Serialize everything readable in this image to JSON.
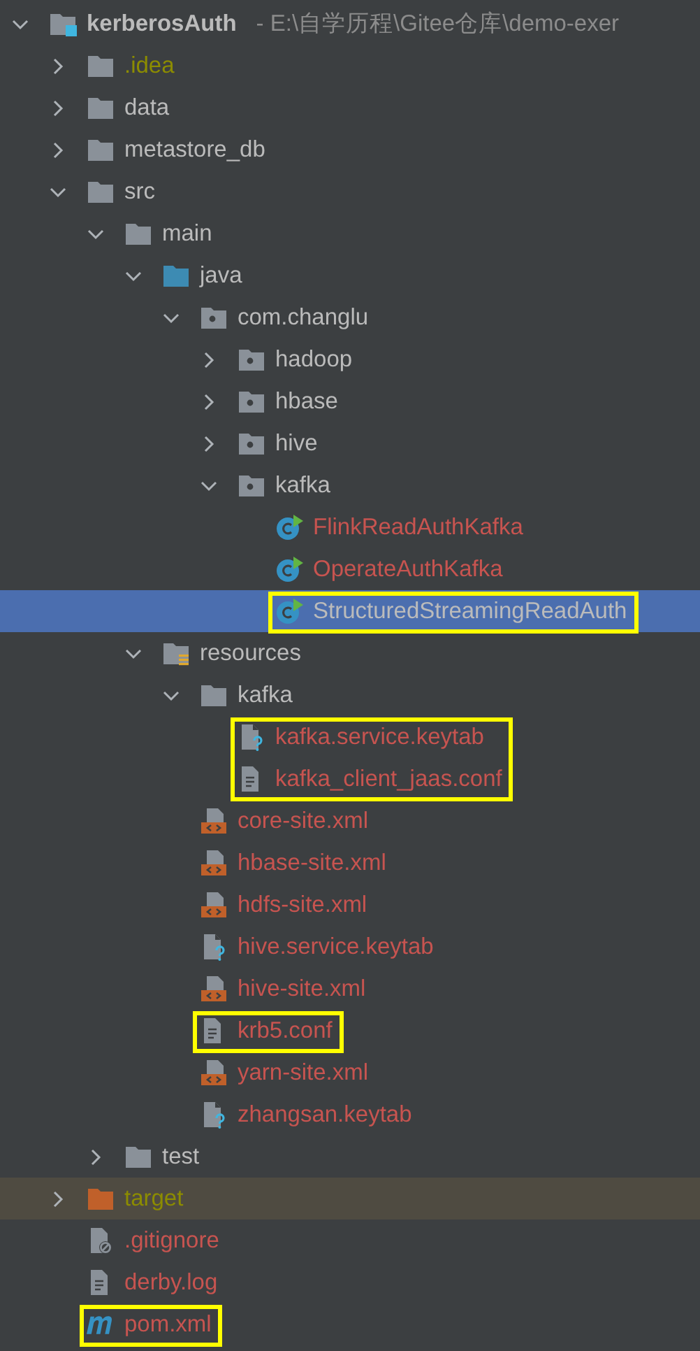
{
  "project_tree": [
    {
      "name": "kerberosAuth",
      "path": "- E:\\自学历程\\Gitee仓库\\demo-exer",
      "kind": "module",
      "expanded": true,
      "selected": false,
      "color": "#bbbbbb",
      "children": [
        {
          "name": ".idea",
          "kind": "folder",
          "expanded": false,
          "selected": false,
          "color": "#8c8c00"
        },
        {
          "name": "data",
          "kind": "folder",
          "expanded": false,
          "selected": false,
          "color": "#bbbbbb"
        },
        {
          "name": "metastore_db",
          "kind": "folder",
          "expanded": false,
          "selected": false,
          "color": "#bbbbbb"
        },
        {
          "name": "src",
          "kind": "folder",
          "expanded": true,
          "selected": false,
          "color": "#bbbbbb",
          "children": [
            {
              "name": "main",
              "kind": "folder",
              "expanded": true,
              "selected": false,
              "color": "#bbbbbb",
              "children": [
                {
                  "name": "java",
                  "kind": "source-root",
                  "expanded": true,
                  "selected": false,
                  "color": "#bbbbbb",
                  "children": [
                    {
                      "name": "com.changlu",
                      "kind": "package",
                      "expanded": true,
                      "selected": false,
                      "color": "#bbbbbb",
                      "children": [
                        {
                          "name": "hadoop",
                          "kind": "package",
                          "expanded": false,
                          "selected": false,
                          "color": "#bbbbbb"
                        },
                        {
                          "name": "hbase",
                          "kind": "package",
                          "expanded": false,
                          "selected": false,
                          "color": "#bbbbbb"
                        },
                        {
                          "name": "hive",
                          "kind": "package",
                          "expanded": false,
                          "selected": false,
                          "color": "#bbbbbb"
                        },
                        {
                          "name": "kafka",
                          "kind": "package",
                          "expanded": true,
                          "selected": false,
                          "color": "#bbbbbb",
                          "children": [
                            {
                              "name": "FlinkReadAuthKafka",
                              "kind": "class",
                              "selected": false,
                              "color": "#c75450"
                            },
                            {
                              "name": "OperateAuthKafka",
                              "kind": "class",
                              "selected": false,
                              "color": "#c75450"
                            },
                            {
                              "name": "StructuredStreamingReadAuth",
                              "kind": "class",
                              "selected": true,
                              "color": "#bbbbbb",
                              "highlighted": true
                            }
                          ]
                        }
                      ]
                    }
                  ]
                },
                {
                  "name": "resources",
                  "kind": "resource-root",
                  "expanded": true,
                  "selected": false,
                  "color": "#bbbbbb",
                  "children": [
                    {
                      "name": "kafka",
                      "kind": "folder",
                      "expanded": true,
                      "selected": false,
                      "color": "#bbbbbb",
                      "children": [
                        {
                          "name": "kafka.service.keytab",
                          "kind": "keytab",
                          "selected": false,
                          "color": "#c75450",
                          "highlighted": true
                        },
                        {
                          "name": "kafka_client_jaas.conf",
                          "kind": "text",
                          "selected": false,
                          "color": "#c75450",
                          "highlighted": true
                        }
                      ]
                    },
                    {
                      "name": "core-site.xml",
                      "kind": "xml",
                      "selected": false,
                      "color": "#c75450"
                    },
                    {
                      "name": "hbase-site.xml",
                      "kind": "xml",
                      "selected": false,
                      "color": "#c75450"
                    },
                    {
                      "name": "hdfs-site.xml",
                      "kind": "xml",
                      "selected": false,
                      "color": "#c75450"
                    },
                    {
                      "name": "hive.service.keytab",
                      "kind": "keytab",
                      "selected": false,
                      "color": "#c75450"
                    },
                    {
                      "name": "hive-site.xml",
                      "kind": "xml",
                      "selected": false,
                      "color": "#c75450"
                    },
                    {
                      "name": "krb5.conf",
                      "kind": "text",
                      "selected": false,
                      "color": "#c75450",
                      "highlighted": true
                    },
                    {
                      "name": "yarn-site.xml",
                      "kind": "xml",
                      "selected": false,
                      "color": "#c75450"
                    },
                    {
                      "name": "zhangsan.keytab",
                      "kind": "keytab",
                      "selected": false,
                      "color": "#c75450"
                    }
                  ]
                }
              ]
            },
            {
              "name": "test",
              "kind": "folder",
              "expanded": false,
              "selected": false,
              "color": "#bbbbbb"
            }
          ]
        },
        {
          "name": "target",
          "kind": "excluded-folder",
          "expanded": false,
          "selected": false,
          "color": "#8c8c00",
          "excluded": true
        },
        {
          "name": ".gitignore",
          "kind": "gitignore",
          "selected": false,
          "color": "#c75450"
        },
        {
          "name": "derby.log",
          "kind": "text",
          "selected": false,
          "color": "#c75450"
        },
        {
          "name": "pom.xml",
          "kind": "maven",
          "selected": false,
          "color": "#c75450",
          "highlighted": true
        }
      ]
    }
  ]
}
